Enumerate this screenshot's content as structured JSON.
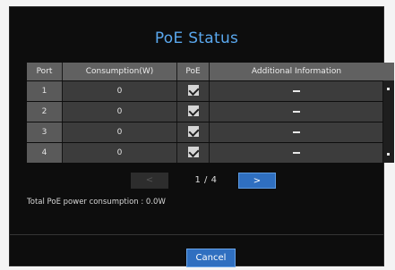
{
  "dialog": {
    "title": "PoE Status"
  },
  "table": {
    "columns": [
      "Port",
      "Consumption(W)",
      "PoE",
      "Additional Information"
    ],
    "rows": [
      {
        "port": "1",
        "consumption": "0",
        "poe": true,
        "info": "-"
      },
      {
        "port": "2",
        "consumption": "0",
        "poe": true,
        "info": "-"
      },
      {
        "port": "3",
        "consumption": "0",
        "poe": true,
        "info": "-"
      },
      {
        "port": "4",
        "consumption": "0",
        "poe": true,
        "info": "-"
      }
    ]
  },
  "pagination": {
    "prev_label": "<",
    "next_label": ">",
    "page_text": "1 / 4"
  },
  "summary": {
    "total_text": "Total PoE power consumption : 0.0W"
  },
  "footer": {
    "cancel_label": "Cancel"
  },
  "colors": {
    "title": "#5aa8ee",
    "accent_button": "#2f6fc0",
    "background": "#0d0d0d"
  },
  "icons": {
    "checkbox": "checkbox-checked-icon",
    "scroll_up": "scroll-up-icon",
    "scroll_down": "scroll-down-icon"
  }
}
